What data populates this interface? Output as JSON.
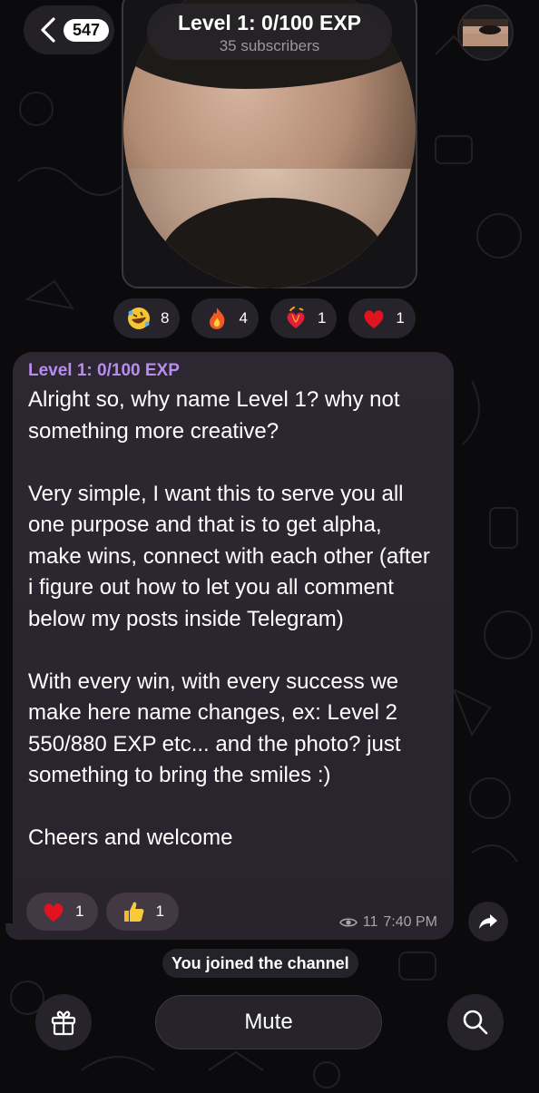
{
  "header": {
    "back_count": "547",
    "channel_title": "Level 1: 0/100 EXP",
    "subscribers": "35 subscribers"
  },
  "reactions_top": [
    {
      "icon": "rolling-laughing-emoji",
      "count": "8"
    },
    {
      "icon": "fire-emoji",
      "count": "4"
    },
    {
      "icon": "heart-on-fire-emoji",
      "count": "1"
    },
    {
      "icon": "red-heart-emoji",
      "count": "1"
    }
  ],
  "message": {
    "sender": "Level 1: 0/100 EXP",
    "text": "Alright so, why name Level 1? why not something more creative?\n\nVery simple, I want this to serve you all one purpose and that is to get alpha, make wins, connect with each other (after i figure out how to let you all comment below my posts inside Telegram)\n\nWith every win, with every success we make here name changes, ex: Level 2 550/880 EXP etc... and the photo? just something to bring the smiles :)\n\nCheers and welcome",
    "reactions": [
      {
        "icon": "red-heart-emoji",
        "count": "1"
      },
      {
        "icon": "thumbs-up-emoji",
        "count": "1"
      }
    ],
    "views": "11",
    "time": "7:40 PM"
  },
  "service_message": "You joined the channel",
  "bottom_bar": {
    "mute_label": "Mute"
  },
  "colors": {
    "sender_name": "#b88df0",
    "bubble": "#2c2730",
    "background": "#0b0a0c"
  }
}
